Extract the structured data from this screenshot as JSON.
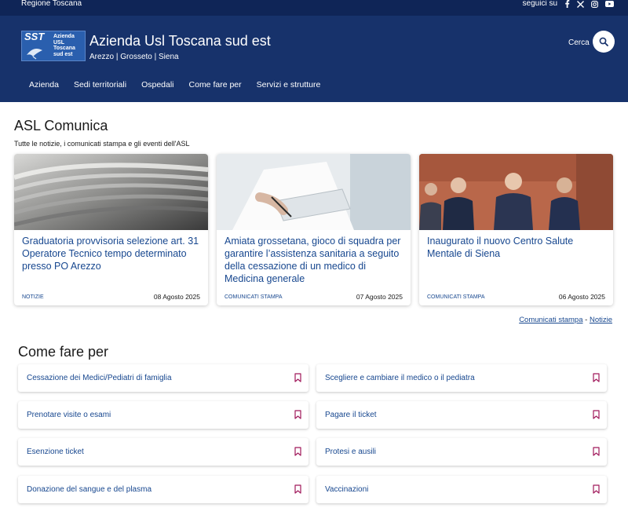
{
  "top_bar": {
    "region": "Regione Toscana",
    "follow_label": "seguici su",
    "social": [
      "facebook-icon",
      "x-icon",
      "instagram-icon",
      "youtube-icon"
    ]
  },
  "header": {
    "logo": {
      "sst": "SST",
      "line1": "Azienda",
      "line2": "USL",
      "line3": "Toscana",
      "line4": "sud est"
    },
    "title": "Azienda Usl Toscana sud est",
    "subtitle": "Arezzo | Grosseto | Siena",
    "search_label": "Cerca",
    "nav": [
      "Azienda",
      "Sedi territoriali",
      "Ospedali",
      "Come fare per",
      "Servizi e strutture"
    ]
  },
  "news": {
    "title": "ASL Comunica",
    "subtitle": "Tutte le notizie, i comunicati stampa e gli eventi dell'ASL",
    "cards": [
      {
        "title": "Graduatoria provvisoria selezione art. 31 Operatore Tecnico tempo determinato presso PO Arezzo",
        "category": "NOTIZIE",
        "date": "08 Agosto 2025"
      },
      {
        "title": "Amiata grossetana, gioco di squadra per garantire l’assistenza sanitaria a seguito della cessazione di un medico di Medicina generale",
        "category": "COMUNICATI STAMPA",
        "date": "07 Agosto 2025"
      },
      {
        "title": "Inaugurato il nuovo Centro Salute Mentale di Siena",
        "category": "COMUNICATI STAMPA",
        "date": "06 Agosto 2025"
      }
    ],
    "link_press": "Comunicati stampa",
    "link_sep": "-",
    "link_news": "Notizie"
  },
  "howto": {
    "title": "Come fare per",
    "items": [
      "Cessazione dei Medici/Pediatri di famiglia",
      "Scegliere e cambiare il medico o il pediatra",
      "Prenotare visite o esami",
      "Pagare il ticket",
      "Esenzione ticket",
      "Protesi e ausili",
      "Donazione del sangue e del plasma",
      "Vaccinazioni"
    ]
  },
  "colors": {
    "top_bar": "#0f2557",
    "header": "#17326b",
    "link": "#17478f",
    "bookmark": "#a0195b"
  }
}
